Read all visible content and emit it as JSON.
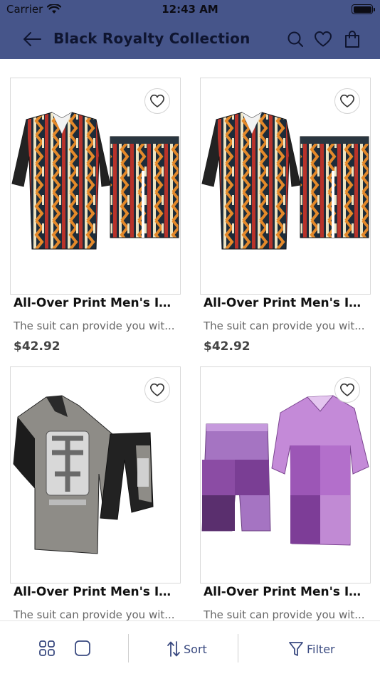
{
  "status_bar": {
    "carrier": "Carrier",
    "time": "12:43 AM"
  },
  "nav": {
    "title": "Black Royalty Collection",
    "icons": [
      "back-arrow-icon",
      "search-icon",
      "heart-icon",
      "shopping-bag-icon"
    ]
  },
  "products": [
    {
      "name": "All-Over Print Men's Imit...",
      "description": "The suit can provide you wit...",
      "price": "$42.92",
      "image": "patterned-shirt-shorts-set"
    },
    {
      "name": "All-Over Print Men's Imit...",
      "description": "The suit can provide you wit...",
      "price": "$42.92",
      "image": "patterned-shirt-shorts-set"
    },
    {
      "name": "All-Over Print Men's Imit...",
      "description": "The suit can provide you wit...",
      "price": "",
      "image": "gray-black-monogram-set"
    },
    {
      "name": "All-Over Print Men's Imit...",
      "description": "The suit can provide you wit...",
      "price": "",
      "image": "purple-colorblock-set"
    }
  ],
  "bottom_bar": {
    "sort_label": "Sort",
    "filter_label": "Filter"
  },
  "colors": {
    "header_bg": "#46558a",
    "accent": "#3a4a80",
    "title_text": "#0f1530"
  }
}
